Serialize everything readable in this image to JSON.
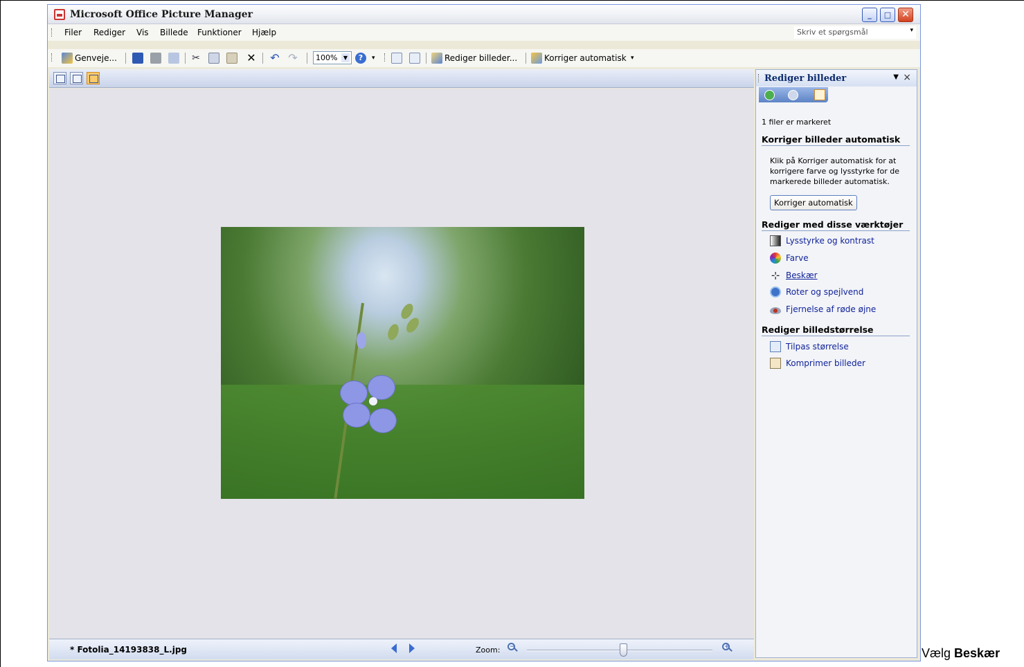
{
  "window": {
    "title": "Microsoft Office Picture Manager"
  },
  "menubar": {
    "items": [
      "Filer",
      "Rediger",
      "Vis",
      "Billede",
      "Funktioner",
      "Hjælp"
    ],
    "help_placeholder": "Skriv et spørgsmål"
  },
  "toolbar": {
    "shortcuts_label": "Genveje...",
    "zoom_value": "100%",
    "edit_pictures_label": "Rediger billeder...",
    "auto_correct_label": "Korriger automatisk"
  },
  "statusbar": {
    "file_name": "* Fotolia_14193838_L.jpg",
    "zoom_label": "Zoom:",
    "zoom_level": 0.52
  },
  "taskpane": {
    "title": "Rediger billeder",
    "selected_info": "1 filer er markeret",
    "auto_section": {
      "heading": "Korriger billeder automatisk",
      "description": "Klik på Korriger automatisk for at korrigere farve og lysstyrke for de markerede billeder automatisk.",
      "button": "Korriger automatisk"
    },
    "tools_section": {
      "heading": "Rediger med disse værktøjer",
      "links": [
        {
          "label": "Lysstyrke og kontrast",
          "icon": "brightness-icon"
        },
        {
          "label": "Farve",
          "icon": "color-wheel-icon"
        },
        {
          "label": "Beskær",
          "icon": "crop-icon"
        },
        {
          "label": "Roter og spejlvend",
          "icon": "rotate-icon"
        },
        {
          "label": "Fjernelse af røde øjne",
          "icon": "red-eye-icon"
        }
      ]
    },
    "size_section": {
      "heading": "Rediger billedstørrelse",
      "links": [
        {
          "label": "Tilpas størrelse",
          "icon": "resize-icon"
        },
        {
          "label": "Komprimer billeder",
          "icon": "compress-icon"
        }
      ]
    }
  },
  "caption": {
    "prefix": "Vælg ",
    "bold": "Beskær"
  }
}
